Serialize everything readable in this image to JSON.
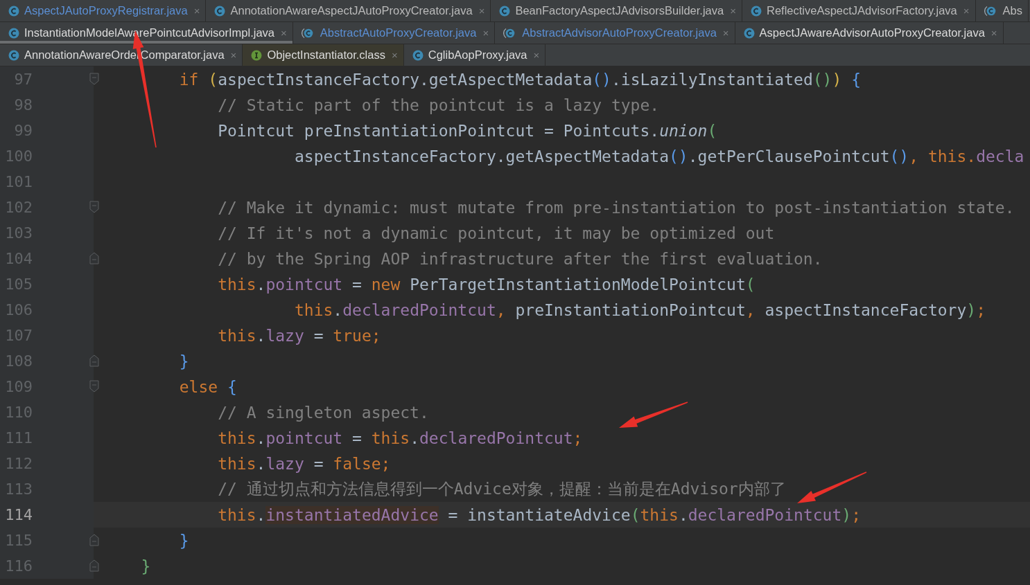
{
  "tab_rows": [
    {
      "tabs": [
        {
          "label": "AspectJAutoProxyRegistrar.java",
          "kind": "class",
          "selected": false,
          "library": false,
          "color": "#5b8fd4",
          "close": "×"
        },
        {
          "label": "AnnotationAwareAspectJAutoProxyCreator.java",
          "kind": "class",
          "selected": false,
          "library": false,
          "color": "#bbbbbb",
          "close": "×"
        },
        {
          "label": "BeanFactoryAspectJAdvisorsBuilder.java",
          "kind": "class",
          "selected": false,
          "library": false,
          "color": "#bbbbbb",
          "close": "×"
        },
        {
          "label": "ReflectiveAspectJAdvisorFactory.java",
          "kind": "class",
          "selected": false,
          "library": false,
          "color": "#bbbbbb",
          "close": "×"
        },
        {
          "label": "Abs",
          "kind": "abstract",
          "selected": false,
          "library": false,
          "color": "#bbbbbb"
        }
      ]
    },
    {
      "tabs": [
        {
          "label": "InstantiationModelAwarePointcutAdvisorImpl.java",
          "kind": "class",
          "selected": true,
          "library": false,
          "color": "#dcdcdc",
          "close": "×"
        },
        {
          "label": "AbstractAutoProxyCreator.java",
          "kind": "abstract",
          "selected": false,
          "library": false,
          "color": "#5b8fd4",
          "close": "×"
        },
        {
          "label": "AbstractAdvisorAutoProxyCreator.java",
          "kind": "abstract",
          "selected": false,
          "library": false,
          "color": "#5b8fd4",
          "close": "×"
        },
        {
          "label": "AspectJAwareAdvisorAutoProxyCreator.java",
          "kind": "class",
          "selected": false,
          "library": false,
          "color": "#dcdcdc",
          "close": "×"
        }
      ]
    },
    {
      "tabs": [
        {
          "label": "AnnotationAwareOrderComparator.java",
          "kind": "class",
          "selected": false,
          "library": false,
          "color": "#dcdcdc",
          "close": "×"
        },
        {
          "label": "ObjectInstantiator.class",
          "kind": "interface",
          "selected": false,
          "library": true,
          "color": "#dcdcdc",
          "close": "×"
        },
        {
          "label": "CglibAopProxy.java",
          "kind": "class",
          "selected": false,
          "library": false,
          "color": "#dcdcdc",
          "close": "×"
        }
      ]
    }
  ],
  "editor": {
    "lines": [
      {
        "number": "97",
        "kind": "fold-start",
        "current": false,
        "tokens": [
          {
            "kind": "kw",
            "text": "        if "
          },
          {
            "kind": "p1",
            "text": "("
          },
          {
            "kind": "plain",
            "text": "aspectInstanceFactory.getAspectMetadata"
          },
          {
            "kind": "p3",
            "text": "()"
          },
          {
            "kind": "plain",
            "text": ".isLazilyInstantiated"
          },
          {
            "kind": "p2",
            "text": "()"
          },
          {
            "kind": "p1",
            "text": ")"
          },
          {
            "kind": "p3",
            "text": " {"
          }
        ]
      },
      {
        "number": "98",
        "kind": "plain",
        "current": false,
        "tokens": [
          {
            "kind": "comment",
            "text": "            // Static part of the pointcut is a lazy type."
          }
        ]
      },
      {
        "number": "99",
        "kind": "plain",
        "current": false,
        "tokens": [
          {
            "kind": "plain",
            "text": "            Pointcut preInstantiationPointcut = Pointcuts."
          },
          {
            "kind": "static",
            "text": "union"
          },
          {
            "kind": "p2",
            "text": "("
          }
        ]
      },
      {
        "number": "100",
        "kind": "plain",
        "current": false,
        "tokens": [
          {
            "kind": "plain",
            "text": "                    aspectInstanceFactory.getAspectMetadata"
          },
          {
            "kind": "p3",
            "text": "()"
          },
          {
            "kind": "plain",
            "text": ".getPerClausePointcut"
          },
          {
            "kind": "p3",
            "text": "()"
          },
          {
            "kind": "kw",
            "text": ", this."
          },
          {
            "kind": "field",
            "text": "decla"
          }
        ]
      },
      {
        "number": "101",
        "kind": "plain",
        "current": false
      },
      {
        "number": "102",
        "kind": "fold-start",
        "current": false,
        "tokens": [
          {
            "kind": "comment",
            "text": "            // Make it dynamic: must mutate from pre-instantiation to post-instantiation state."
          }
        ]
      },
      {
        "number": "103",
        "kind": "plain",
        "current": false,
        "tokens": [
          {
            "kind": "comment",
            "text": "            // If it's not a dynamic pointcut, it may be optimized out"
          }
        ]
      },
      {
        "number": "104",
        "kind": "fold-end",
        "current": false,
        "tokens": [
          {
            "kind": "comment",
            "text": "            // by the Spring AOP infrastructure after the first evaluation."
          }
        ]
      },
      {
        "number": "105",
        "kind": "plain",
        "current": false,
        "tokens": [
          {
            "kind": "kw",
            "text": "            this"
          },
          {
            "kind": "plain",
            "text": "."
          },
          {
            "kind": "field",
            "text": "pointcut"
          },
          {
            "kind": "plain",
            "text": " = "
          },
          {
            "kind": "kw",
            "text": "new "
          },
          {
            "kind": "plain",
            "text": "PerTargetInstantiationModelPointcut"
          },
          {
            "kind": "p2",
            "text": "("
          }
        ]
      },
      {
        "number": "106",
        "kind": "plain",
        "current": false,
        "tokens": [
          {
            "kind": "kw",
            "text": "                    this"
          },
          {
            "kind": "plain",
            "text": "."
          },
          {
            "kind": "field",
            "text": "declaredPointcut"
          },
          {
            "kind": "kw",
            "text": ", "
          },
          {
            "kind": "plain",
            "text": "preInstantiationPointcut"
          },
          {
            "kind": "kw",
            "text": ", "
          },
          {
            "kind": "plain",
            "text": "aspectInstanceFactory"
          },
          {
            "kind": "p2",
            "text": ")"
          },
          {
            "kind": "kw",
            "text": ";"
          }
        ]
      },
      {
        "number": "107",
        "kind": "plain",
        "current": false,
        "tokens": [
          {
            "kind": "kw",
            "text": "            this"
          },
          {
            "kind": "plain",
            "text": "."
          },
          {
            "kind": "field",
            "text": "lazy"
          },
          {
            "kind": "plain",
            "text": " = "
          },
          {
            "kind": "kw",
            "text": "true;"
          }
        ]
      },
      {
        "number": "108",
        "kind": "fold-end",
        "current": false,
        "tokens": [
          {
            "kind": "p3",
            "text": "        }"
          }
        ]
      },
      {
        "number": "109",
        "kind": "fold-start",
        "current": false,
        "tokens": [
          {
            "kind": "kw",
            "text": "        else "
          },
          {
            "kind": "p3",
            "text": "{"
          }
        ]
      },
      {
        "number": "110",
        "kind": "plain",
        "current": false,
        "tokens": [
          {
            "kind": "comment",
            "text": "            // A singleton aspect."
          }
        ]
      },
      {
        "number": "111",
        "kind": "plain",
        "current": false,
        "tokens": [
          {
            "kind": "kw",
            "text": "            this"
          },
          {
            "kind": "plain",
            "text": "."
          },
          {
            "kind": "field",
            "text": "pointcut"
          },
          {
            "kind": "plain",
            "text": " = "
          },
          {
            "kind": "kw",
            "text": "this"
          },
          {
            "kind": "plain",
            "text": "."
          },
          {
            "kind": "field",
            "text": "declaredPointcut"
          },
          {
            "kind": "kw",
            "text": ";"
          }
        ]
      },
      {
        "number": "112",
        "kind": "plain",
        "current": false,
        "tokens": [
          {
            "kind": "kw",
            "text": "            this"
          },
          {
            "kind": "plain",
            "text": "."
          },
          {
            "kind": "field",
            "text": "lazy"
          },
          {
            "kind": "plain",
            "text": " = "
          },
          {
            "kind": "kw",
            "text": "false;"
          }
        ]
      },
      {
        "number": "113",
        "kind": "plain",
        "current": false,
        "tokens": [
          {
            "kind": "comment",
            "text": "            // 通过切点和方法信息得到一个Advice对象，提醒：当前是在Advisor内部了"
          }
        ]
      },
      {
        "number": "114",
        "kind": "plain",
        "current": true,
        "tokens": [
          {
            "kind": "kw",
            "text": "            this"
          },
          {
            "kind": "plain",
            "text": "."
          },
          {
            "kind": "fieldhl",
            "text": "instantiatedAdvice"
          },
          {
            "kind": "plain",
            "text": " = instantiateAdvice"
          },
          {
            "kind": "p2",
            "text": "("
          },
          {
            "kind": "kw",
            "text": "this"
          },
          {
            "kind": "plain",
            "text": "."
          },
          {
            "kind": "field",
            "text": "declaredPointcut"
          },
          {
            "kind": "p2",
            "text": ")"
          },
          {
            "kind": "kw",
            "text": ";"
          }
        ]
      },
      {
        "number": "115",
        "kind": "fold-end",
        "current": false,
        "tokens": [
          {
            "kind": "p3",
            "text": "        }"
          }
        ]
      },
      {
        "number": "116",
        "kind": "fold-end",
        "current": false,
        "tokens": [
          {
            "kind": "p2",
            "text": "    }"
          }
        ]
      }
    ]
  }
}
